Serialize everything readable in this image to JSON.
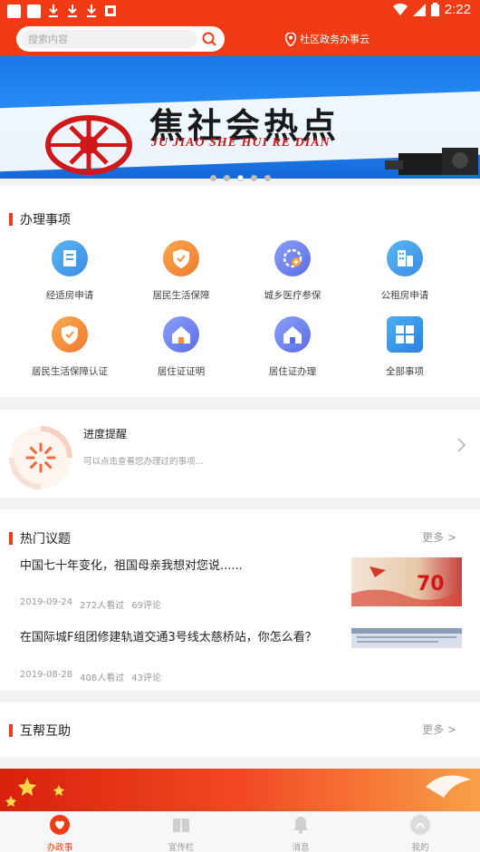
{
  "status_bar": {
    "time": "2:22"
  },
  "header": {
    "search_placeholder": "搜索内容",
    "location_label": "社区政务办事云"
  },
  "banner": {
    "title": "焦社会热点",
    "subtitle": "JU JIAO SHE HUI RE DIAN",
    "page_count": 5,
    "active_index": 2
  },
  "services": {
    "heading": "办理事项",
    "items": [
      {
        "label": "经适房申请",
        "icon": "document-icon",
        "color": "#4aa8ec"
      },
      {
        "label": "居民生活保障",
        "icon": "shield-icon",
        "color": "#f5903c"
      },
      {
        "label": "城乡医疗参保",
        "icon": "medical-icon",
        "color": "#6c84f0"
      },
      {
        "label": "公租房申请",
        "icon": "building-icon",
        "color": "#4aa8ec"
      },
      {
        "label": "居民生活保障认证",
        "icon": "shield-check-icon",
        "color": "#f5903c"
      },
      {
        "label": "居住证证明",
        "icon": "house-icon",
        "color": "#6c84f0"
      },
      {
        "label": "居住证办理",
        "icon": "house-icon",
        "color": "#6c84f0"
      },
      {
        "label": "全部事项",
        "icon": "grid-icon",
        "color": "#3a9ae8"
      }
    ]
  },
  "progress": {
    "title": "进度提醒",
    "subtitle": "可以点击查看您办理过的事项..."
  },
  "topics": {
    "heading": "热门议题",
    "more": "更多 >",
    "items": [
      {
        "title": "中国七十年变化，祖国母亲我想对您说......",
        "date": "2019-09-24",
        "views": "272人看过",
        "comments": "69评论",
        "thumb_text": "70"
      },
      {
        "title": "在国际城F组团修建轨道交通3号线太慈桥站，你怎么看？",
        "date": "2019-08-28",
        "views": "408人看过",
        "comments": "43评论"
      }
    ]
  },
  "mutual": {
    "heading": "互帮互助",
    "more": "更多 >"
  },
  "nav": {
    "items": [
      {
        "label": "办政事",
        "icon": "heart-icon",
        "active": true
      },
      {
        "label": "宣传栏",
        "icon": "book-icon",
        "active": false
      },
      {
        "label": "消息",
        "icon": "bell-icon",
        "active": false
      },
      {
        "label": "我的",
        "icon": "profile-icon",
        "active": false
      }
    ]
  },
  "colors": {
    "primary": "#f03b14",
    "banner_blue": "#1a78e8"
  }
}
